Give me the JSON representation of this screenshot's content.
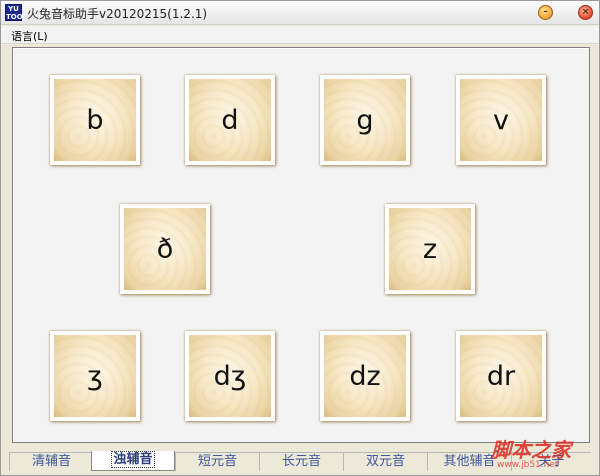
{
  "window": {
    "title": "火兔音标助手v20120215(1.2.1)",
    "icon_text_top": "YU",
    "icon_text_bottom": "TOOL"
  },
  "menu": {
    "language": "语言(L)"
  },
  "cards": [
    {
      "symbol": "b"
    },
    {
      "symbol": "d"
    },
    {
      "symbol": "g"
    },
    {
      "symbol": "v"
    },
    {
      "symbol": "ð"
    },
    {
      "symbol": "z"
    },
    {
      "symbol": "ʒ"
    },
    {
      "symbol": "dʒ"
    },
    {
      "symbol": "dz"
    },
    {
      "symbol": "dr"
    }
  ],
  "tabs": [
    {
      "label": "清辅音",
      "active": false
    },
    {
      "label": "浊辅音",
      "active": true
    },
    {
      "label": "短元音",
      "active": false
    },
    {
      "label": "长元音",
      "active": false
    },
    {
      "label": "双元音",
      "active": false
    },
    {
      "label": "其他辅音",
      "active": false
    },
    {
      "label": "关于",
      "active": false
    }
  ],
  "watermark": {
    "main": "脚本之家",
    "sub": "www.jb51.net"
  },
  "colors": {
    "tab_text": "#3f57a0",
    "watermark": "#dc281e",
    "card_paper": "#f7e9c9"
  }
}
